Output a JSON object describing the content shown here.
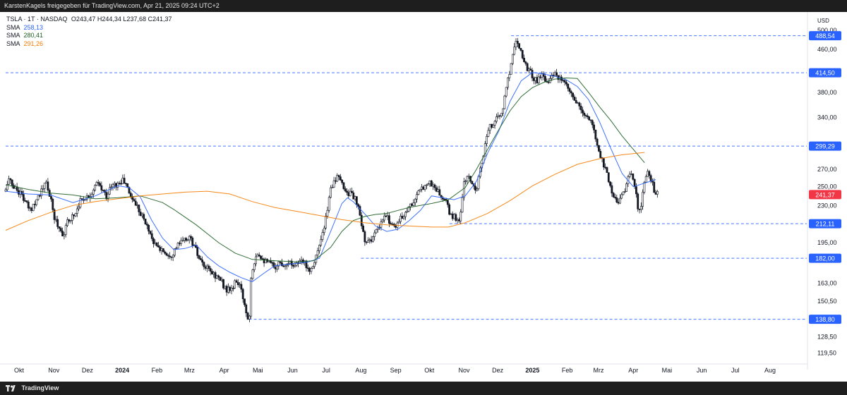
{
  "header": {
    "text": "KarstenKagels freigegeben für TradingView.com, Apr 21, 2025 09:24 UTC+2"
  },
  "legend": {
    "symbol": "TSLA · 1T · NASDAQ",
    "ohlc": "O243,47 H244,34 L237,68 C241,37",
    "sma": [
      {
        "label": "SMA",
        "value": "258,13",
        "color": "#2962ff"
      },
      {
        "label": "SMA",
        "value": "280,41",
        "color": "#1b5e20"
      },
      {
        "label": "SMA",
        "value": "291,26",
        "color": "#f57c00"
      }
    ]
  },
  "footer": {
    "brand": "TradingView"
  },
  "chart_data": {
    "type": "candlestick",
    "currency": "USD",
    "scale": "log",
    "ylim": [
      116,
      505
    ],
    "y_ticks": [
      "500,00",
      "460,00",
      "380,00",
      "340,00",
      "270,00",
      "250,00",
      "230,00",
      "195,00",
      "163,00",
      "150,50",
      "128,50",
      "119,50"
    ],
    "x_ticks": [
      {
        "label": "Okt",
        "day": 12
      },
      {
        "label": "Nov",
        "day": 43
      },
      {
        "label": "Dez",
        "day": 73
      },
      {
        "label": "2024",
        "day": 104,
        "bold": true
      },
      {
        "label": "Feb",
        "day": 135
      },
      {
        "label": "Mrz",
        "day": 164
      },
      {
        "label": "Apr",
        "day": 195
      },
      {
        "label": "Mai",
        "day": 225
      },
      {
        "label": "Jun",
        "day": 256
      },
      {
        "label": "Jul",
        "day": 286
      },
      {
        "label": "Aug",
        "day": 317
      },
      {
        "label": "Sep",
        "day": 348
      },
      {
        "label": "Okt",
        "day": 378
      },
      {
        "label": "Nov",
        "day": 409
      },
      {
        "label": "Dez",
        "day": 439
      },
      {
        "label": "2025",
        "day": 470,
        "bold": true
      },
      {
        "label": "Feb",
        "day": 501
      },
      {
        "label": "Mrz",
        "day": 529
      },
      {
        "label": "Apr",
        "day": 560
      },
      {
        "label": "Mai",
        "day": 590
      },
      {
        "label": "Jun",
        "day": 621
      },
      {
        "label": "Jul",
        "day": 651
      },
      {
        "label": "Aug",
        "day": 682
      }
    ],
    "levels": [
      {
        "value": 488.54,
        "label": "488,54",
        "x_start_day": 451
      },
      {
        "value": 414.5,
        "label": "414,50",
        "x_start_day": 0
      },
      {
        "value": 299.29,
        "label": "299,29",
        "x_start_day": 0
      },
      {
        "value": 212.11,
        "label": "212,11",
        "x_start_day": 396
      },
      {
        "value": 182.0,
        "label": "182,00",
        "x_start_day": 317
      },
      {
        "value": 138.8,
        "label": "138,80",
        "x_start_day": 217
      }
    ],
    "last_price": {
      "value": 241.37,
      "label": "241,37",
      "color": "#f23645"
    },
    "price_path": [
      [
        0,
        245
      ],
      [
        2,
        260
      ],
      [
        5,
        253
      ],
      [
        9,
        248
      ],
      [
        14,
        242
      ],
      [
        18,
        232
      ],
      [
        22,
        225
      ],
      [
        26,
        234
      ],
      [
        30,
        242
      ],
      [
        33,
        247
      ],
      [
        36,
        255
      ],
      [
        40,
        237
      ],
      [
        43,
        219
      ],
      [
        46,
        212
      ],
      [
        49,
        206
      ],
      [
        52,
        202
      ],
      [
        55,
        213
      ],
      [
        58,
        218
      ],
      [
        62,
        222
      ],
      [
        66,
        234
      ],
      [
        70,
        238
      ],
      [
        74,
        240
      ],
      [
        78,
        246
      ],
      [
        82,
        254
      ],
      [
        86,
        246
      ],
      [
        90,
        240
      ],
      [
        94,
        250
      ],
      [
        98,
        252
      ],
      [
        102,
        254
      ],
      [
        105,
        258
      ],
      [
        108,
        250
      ],
      [
        110,
        244
      ],
      [
        113,
        237
      ],
      [
        116,
        232
      ],
      [
        119,
        226
      ],
      [
        122,
        219
      ],
      [
        125,
        212
      ],
      [
        128,
        206
      ],
      [
        131,
        198
      ],
      [
        134,
        192
      ],
      [
        137,
        190
      ],
      [
        140,
        189
      ],
      [
        143,
        186
      ],
      [
        146,
        185
      ],
      [
        149,
        186
      ],
      [
        152,
        191
      ],
      [
        155,
        194
      ],
      [
        158,
        196
      ],
      [
        161,
        198
      ],
      [
        164,
        200
      ],
      [
        167,
        194
      ],
      [
        170,
        188
      ],
      [
        173,
        180
      ],
      [
        176,
        176
      ],
      [
        179,
        174
      ],
      [
        182,
        172
      ],
      [
        185,
        170
      ],
      [
        188,
        168
      ],
      [
        191,
        166
      ],
      [
        194,
        162
      ],
      [
        197,
        158
      ],
      [
        200,
        158
      ],
      [
        203,
        160
      ],
      [
        206,
        165
      ],
      [
        209,
        160
      ],
      [
        212,
        152
      ],
      [
        214,
        146
      ],
      [
        216,
        139
      ],
      [
        218,
        143
      ],
      [
        219,
        170
      ],
      [
        221,
        177
      ],
      [
        224,
        187
      ],
      [
        227,
        185
      ],
      [
        230,
        181
      ],
      [
        233,
        178
      ],
      [
        236,
        178
      ],
      [
        240,
        175
      ],
      [
        243,
        178
      ],
      [
        246,
        178
      ],
      [
        249,
        177
      ],
      [
        252,
        180
      ],
      [
        255,
        177
      ],
      [
        258,
        178
      ],
      [
        262,
        178
      ],
      [
        266,
        179
      ],
      [
        269,
        176
      ],
      [
        272,
        172
      ],
      [
        275,
        180
      ],
      [
        278,
        186
      ],
      [
        281,
        196
      ],
      [
        284,
        206
      ],
      [
        287,
        226
      ],
      [
        290,
        248
      ],
      [
        293,
        258
      ],
      [
        296,
        260
      ],
      [
        299,
        255
      ],
      [
        302,
        249
      ],
      [
        304,
        244
      ],
      [
        307,
        243
      ],
      [
        310,
        240
      ],
      [
        313,
        233
      ],
      [
        316,
        220
      ],
      [
        318,
        207
      ],
      [
        320,
        200
      ],
      [
        322,
        193
      ],
      [
        325,
        197
      ],
      [
        328,
        201
      ],
      [
        331,
        205
      ],
      [
        334,
        209
      ],
      [
        337,
        217
      ],
      [
        340,
        219
      ],
      [
        343,
        214
      ],
      [
        346,
        210
      ],
      [
        349,
        212
      ],
      [
        352,
        216
      ],
      [
        355,
        221
      ],
      [
        358,
        226
      ],
      [
        361,
        230
      ],
      [
        364,
        234
      ],
      [
        366,
        238
      ],
      [
        369,
        244
      ],
      [
        372,
        249
      ],
      [
        375,
        254
      ],
      [
        378,
        255
      ],
      [
        381,
        251
      ],
      [
        384,
        248
      ],
      [
        387,
        241
      ],
      [
        390,
        237
      ],
      [
        393,
        233
      ],
      [
        396,
        222
      ],
      [
        399,
        219
      ],
      [
        402,
        217
      ],
      [
        405,
        215
      ],
      [
        409,
        254
      ],
      [
        412,
        262
      ],
      [
        415,
        256
      ],
      [
        418,
        250
      ],
      [
        420,
        248
      ],
      [
        423,
        268
      ],
      [
        426,
        285
      ],
      [
        429,
        310
      ],
      [
        432,
        325
      ],
      [
        435,
        332
      ],
      [
        438,
        342
      ],
      [
        440,
        340
      ],
      [
        443,
        345
      ],
      [
        446,
        385
      ],
      [
        449,
        410
      ],
      [
        452,
        445
      ],
      [
        454,
        470
      ],
      [
        456,
        480
      ],
      [
        458,
        470
      ],
      [
        460,
        455
      ],
      [
        462,
        440
      ],
      [
        465,
        425
      ],
      [
        468,
        415
      ],
      [
        471,
        405
      ],
      [
        474,
        400
      ],
      [
        477,
        410
      ],
      [
        480,
        408
      ],
      [
        483,
        400
      ],
      [
        486,
        405
      ],
      [
        489,
        412
      ],
      [
        492,
        405
      ],
      [
        495,
        402
      ],
      [
        498,
        395
      ],
      [
        501,
        387
      ],
      [
        504,
        378
      ],
      [
        507,
        368
      ],
      [
        510,
        360
      ],
      [
        513,
        350
      ],
      [
        516,
        345
      ],
      [
        519,
        340
      ],
      [
        522,
        332
      ],
      [
        525,
        320
      ],
      [
        528,
        300
      ],
      [
        531,
        285
      ],
      [
        534,
        275
      ],
      [
        537,
        263
      ],
      [
        540,
        248
      ],
      [
        543,
        238
      ],
      [
        546,
        233
      ],
      [
        549,
        242
      ],
      [
        552,
        245
      ],
      [
        555,
        258
      ],
      [
        558,
        265
      ],
      [
        561,
        255
      ],
      [
        563,
        235
      ],
      [
        565,
        223
      ],
      [
        567,
        230
      ],
      [
        570,
        255
      ],
      [
        573,
        265
      ],
      [
        576,
        258
      ],
      [
        579,
        245
      ],
      [
        582,
        241
      ]
    ],
    "sma_series": [
      {
        "name": "SMA",
        "label": "258,13",
        "color": "#2962ff",
        "points": [
          [
            0,
            245
          ],
          [
            20,
            242
          ],
          [
            40,
            241
          ],
          [
            60,
            233
          ],
          [
            80,
            240
          ],
          [
            100,
            251
          ],
          [
            110,
            249
          ],
          [
            120,
            239
          ],
          [
            130,
            216
          ],
          [
            140,
            199
          ],
          [
            150,
            189
          ],
          [
            160,
            190
          ],
          [
            170,
            193
          ],
          [
            180,
            183
          ],
          [
            190,
            176
          ],
          [
            200,
            171
          ],
          [
            210,
            167
          ],
          [
            220,
            164
          ],
          [
            230,
            170
          ],
          [
            240,
            176
          ],
          [
            250,
            177
          ],
          [
            260,
            178
          ],
          [
            270,
            179
          ],
          [
            280,
            182
          ],
          [
            290,
            205
          ],
          [
            300,
            232
          ],
          [
            305,
            238
          ],
          [
            310,
            234
          ],
          [
            320,
            222
          ],
          [
            330,
            210
          ],
          [
            340,
            205
          ],
          [
            350,
            207
          ],
          [
            360,
            215
          ],
          [
            370,
            225
          ],
          [
            380,
            240
          ],
          [
            390,
            238
          ],
          [
            400,
            236
          ],
          [
            410,
            240
          ],
          [
            420,
            256
          ],
          [
            430,
            290
          ],
          [
            440,
            320
          ],
          [
            450,
            365
          ],
          [
            460,
            400
          ],
          [
            470,
            415
          ],
          [
            480,
            412
          ],
          [
            490,
            408
          ],
          [
            500,
            402
          ],
          [
            510,
            390
          ],
          [
            520,
            368
          ],
          [
            530,
            333
          ],
          [
            540,
            296
          ],
          [
            550,
            265
          ],
          [
            560,
            250
          ],
          [
            570,
            254
          ],
          [
            580,
            258
          ]
        ]
      },
      {
        "name": "SMA",
        "label": "280,41",
        "color": "#1b5e20",
        "points": [
          [
            0,
            252
          ],
          [
            20,
            247
          ],
          [
            40,
            243
          ],
          [
            60,
            241
          ],
          [
            80,
            237
          ],
          [
            100,
            238
          ],
          [
            120,
            240
          ],
          [
            140,
            233
          ],
          [
            150,
            226
          ],
          [
            170,
            211
          ],
          [
            190,
            195
          ],
          [
            205,
            186
          ],
          [
            220,
            181
          ],
          [
            240,
            180
          ],
          [
            260,
            179
          ],
          [
            275,
            180
          ],
          [
            290,
            191
          ],
          [
            300,
            205
          ],
          [
            310,
            215
          ],
          [
            320,
            219
          ],
          [
            330,
            221
          ],
          [
            340,
            222
          ],
          [
            350,
            225
          ],
          [
            360,
            228
          ],
          [
            370,
            230
          ],
          [
            380,
            232
          ],
          [
            395,
            236
          ],
          [
            410,
            249
          ],
          [
            420,
            270
          ],
          [
            430,
            295
          ],
          [
            440,
            322
          ],
          [
            450,
            350
          ],
          [
            460,
            373
          ],
          [
            470,
            388
          ],
          [
            480,
            397
          ],
          [
            490,
            403
          ],
          [
            500,
            405
          ],
          [
            510,
            404
          ],
          [
            520,
            380
          ],
          [
            530,
            356
          ],
          [
            540,
            335
          ],
          [
            550,
            313
          ],
          [
            560,
            295
          ],
          [
            570,
            278
          ]
        ]
      },
      {
        "name": "SMA",
        "label": "291,26",
        "color": "#f57c00",
        "points": [
          [
            0,
            206
          ],
          [
            20,
            215
          ],
          [
            40,
            223
          ],
          [
            60,
            230
          ],
          [
            80,
            234
          ],
          [
            100,
            237
          ],
          [
            120,
            240
          ],
          [
            140,
            242
          ],
          [
            160,
            244
          ],
          [
            180,
            245
          ],
          [
            200,
            242
          ],
          [
            220,
            234
          ],
          [
            240,
            228
          ],
          [
            260,
            224
          ],
          [
            280,
            220
          ],
          [
            300,
            216
          ],
          [
            320,
            213
          ],
          [
            340,
            211
          ],
          [
            360,
            210
          ],
          [
            380,
            209
          ],
          [
            395,
            209
          ],
          [
            410,
            213
          ],
          [
            430,
            222
          ],
          [
            450,
            235
          ],
          [
            470,
            251
          ],
          [
            490,
            264
          ],
          [
            510,
            276
          ],
          [
            530,
            283
          ],
          [
            550,
            288
          ],
          [
            570,
            291
          ]
        ]
      }
    ]
  }
}
